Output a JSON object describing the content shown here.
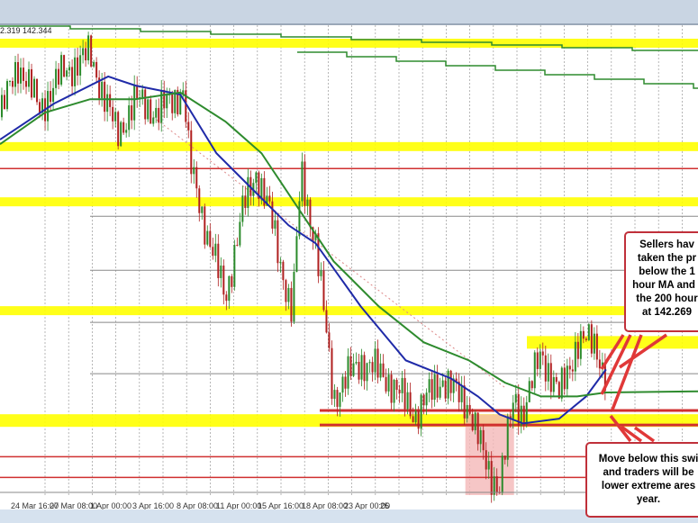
{
  "chart_data": {
    "type": "candlestick",
    "title": "",
    "ohlc_readout": "2.319 142.344",
    "x_tick_labels": [
      "24 Mar 16:00",
      "27 Mar 08:00",
      "1 Apr 00:00",
      "3 Apr 16:00",
      "8 Apr 08:00",
      "11 Apr 00:00",
      "15 Apr 16:00",
      "18 Apr 08:00",
      "23 Apr 00:00",
      "25"
    ],
    "xlim_bars": [
      0,
      387
    ],
    "ylim": [
      140.0,
      152.0
    ],
    "price_path": [
      [
        0,
        149.65
      ],
      [
        10,
        151.03
      ],
      [
        22,
        149.88
      ],
      [
        35,
        150.8
      ],
      [
        50,
        151.26
      ],
      [
        65,
        149.19
      ],
      [
        75,
        150.11
      ],
      [
        87,
        149.77
      ],
      [
        102,
        150.34
      ],
      [
        105,
        148.5
      ],
      [
        115,
        146.66
      ],
      [
        125,
        145.05
      ],
      [
        135,
        147.35
      ],
      [
        142,
        148.27
      ],
      [
        150,
        147.12
      ],
      [
        162,
        144.59
      ],
      [
        167,
        148.27
      ],
      [
        175,
        146.43
      ],
      [
        185,
        142.52
      ],
      [
        200,
        143.44
      ],
      [
        215,
        142.98
      ],
      [
        230,
        142.06
      ],
      [
        245,
        142.98
      ],
      [
        260,
        142.29
      ],
      [
        270,
        140.68
      ],
      [
        277,
        140.22
      ],
      [
        285,
        142.52
      ],
      [
        290,
        142.06
      ],
      [
        300,
        143.67
      ],
      [
        310,
        142.52
      ],
      [
        320,
        143.9
      ],
      [
        330,
        143.9
      ],
      [
        336,
        142.98
      ]
    ],
    "series": [
      {
        "name": "100-hour MA",
        "color": "#1f2aa8",
        "points": [
          [
            0,
            149.08
          ],
          [
            30,
            150.0
          ],
          [
            60,
            150.69
          ],
          [
            75,
            150.46
          ],
          [
            100,
            150.23
          ],
          [
            120,
            148.73
          ],
          [
            140,
            147.81
          ],
          [
            160,
            146.89
          ],
          [
            175,
            146.43
          ],
          [
            200,
            144.82
          ],
          [
            225,
            143.44
          ],
          [
            250,
            142.98
          ],
          [
            265,
            142.52
          ],
          [
            277,
            142.06
          ],
          [
            290,
            141.83
          ],
          [
            310,
            141.95
          ],
          [
            325,
            142.52
          ],
          [
            336,
            143.21
          ]
        ]
      },
      {
        "name": "200-hour MA",
        "color": "#2e8b2e",
        "points": [
          [
            0,
            148.96
          ],
          [
            25,
            149.77
          ],
          [
            50,
            150.11
          ],
          [
            75,
            150.11
          ],
          [
            100,
            150.28
          ],
          [
            125,
            149.54
          ],
          [
            145,
            148.73
          ],
          [
            165,
            147.35
          ],
          [
            185,
            145.97
          ],
          [
            210,
            144.82
          ],
          [
            235,
            143.9
          ],
          [
            260,
            143.44
          ],
          [
            280,
            142.87
          ],
          [
            300,
            142.52
          ],
          [
            320,
            142.52
          ],
          [
            336,
            142.62
          ],
          [
            387,
            142.65
          ]
        ]
      }
    ],
    "levels": {
      "yellow_bands": [
        151.54,
        148.9,
        147.49,
        144.71,
        141.95
      ],
      "yellow_partial_band": 143.9,
      "red_lines": [
        148.34,
        142.16,
        141.79,
        140.98,
        140.45
      ],
      "gray_lines": [
        147.12,
        145.74,
        144.41,
        143.1
      ]
    },
    "shaded_zone": {
      "from_bar": 258,
      "to_bar": 285,
      "low": 140.0,
      "high": 142.06
    },
    "annotations": [
      {
        "id": "sellers",
        "lines": [
          "Sellers hav",
          "taken the pr",
          "below the 1",
          "hour MA and t",
          "the 200 hour",
          "at 142.269"
        ]
      },
      {
        "id": "move-below",
        "lines": [
          "Move below this swi",
          "and traders will be",
          "lower extreme ares",
          "year."
        ]
      }
    ]
  }
}
